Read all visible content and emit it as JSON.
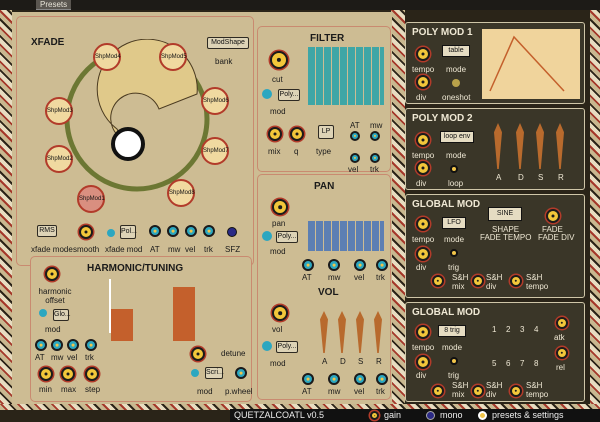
{
  "topbar": {
    "presets": "Presets"
  },
  "xfade": {
    "title": "XFADE",
    "shape_btn": "ModShape",
    "bank": "bank",
    "mods": [
      "ShpMod1",
      "ShpMod2",
      "ShpMod3",
      "ShpMod4",
      "ShpMod5",
      "ShpMod6",
      "ShpMod7",
      "ShpMod8"
    ],
    "rms": "RMS",
    "xfade_mode": "xfade mode",
    "smooth": "smooth",
    "pol": "Pol...",
    "xfade_mod": "xfade mod",
    "at": "AT",
    "mw": "mw",
    "vel": "vel",
    "trk": "trk",
    "sfz": "SFZ"
  },
  "filter": {
    "title": "FILTER",
    "cut": "cut",
    "poly": "Poly...",
    "mod": "mod",
    "mix": "mix",
    "q": "q",
    "type_btn": "LP",
    "type": "type",
    "at": "AT",
    "mw": "mw",
    "vel": "vel",
    "trk": "trk"
  },
  "pan": {
    "title": "PAN",
    "pan": "pan",
    "poly": "Poly...",
    "mod": "mod",
    "at": "AT",
    "mw": "mw",
    "vel": "vel",
    "trk": "trk"
  },
  "vol": {
    "title": "VOL",
    "vol": "vol",
    "poly": "Poly...",
    "mod": "mod",
    "a": "A",
    "d": "D",
    "s": "S",
    "r": "R",
    "at": "AT",
    "mw": "mw",
    "vel": "vel",
    "trk": "trk"
  },
  "harmonic": {
    "title": "HARMONIC/TUNING",
    "offset": "harmonic offset",
    "glo": "Glo...",
    "mod": "mod",
    "at": "AT",
    "mw": "mw",
    "vel": "vel",
    "trk": "trk",
    "min": "min",
    "max": "max",
    "step": "step",
    "detune": "detune",
    "scri": "Scri...",
    "mod2": "mod",
    "pwheel": "p.wheel"
  },
  "polymod1": {
    "title": "POLY MOD 1",
    "tempo": "tempo",
    "mode": "mode",
    "mode_btn": "table",
    "div": "div",
    "oneshot": "oneshot"
  },
  "polymod2": {
    "title": "POLY MOD 2",
    "tempo": "tempo",
    "mode": "mode",
    "mode_btn": "loop env",
    "div": "div",
    "loop": "loop",
    "a": "A",
    "d": "D",
    "s": "S",
    "r": "R"
  },
  "global1": {
    "title": "GLOBAL MOD",
    "tempo": "tempo",
    "mode": "mode",
    "mode_btn": "LFO",
    "div": "div",
    "trig": "trig",
    "shape_btn": "SINE",
    "shape": "SHAPE",
    "fade": "FADE",
    "fade_tempo": "FADE TEMPO",
    "fade_div": "FADE DIV",
    "sh_mix": "S&H mix",
    "sh_div": "S&H div",
    "sh_tempo": "S&H tempo"
  },
  "global2": {
    "title": "GLOBAL MOD",
    "tempo": "tempo",
    "mode": "mode",
    "mode_btn": "8 trig",
    "div": "div",
    "trig": "trig",
    "atk": "atk",
    "rel": "rel",
    "nums": [
      "1",
      "2",
      "3",
      "4",
      "5",
      "6",
      "7",
      "8"
    ],
    "sh_mix": "S&H mix",
    "sh_div": "S&H div",
    "sh_tempo": "S&H tempo"
  },
  "bottom": {
    "version": "QUETZALCOATL v0.5",
    "gain": "gain",
    "mono": "mono",
    "presets": "presets & settings"
  }
}
